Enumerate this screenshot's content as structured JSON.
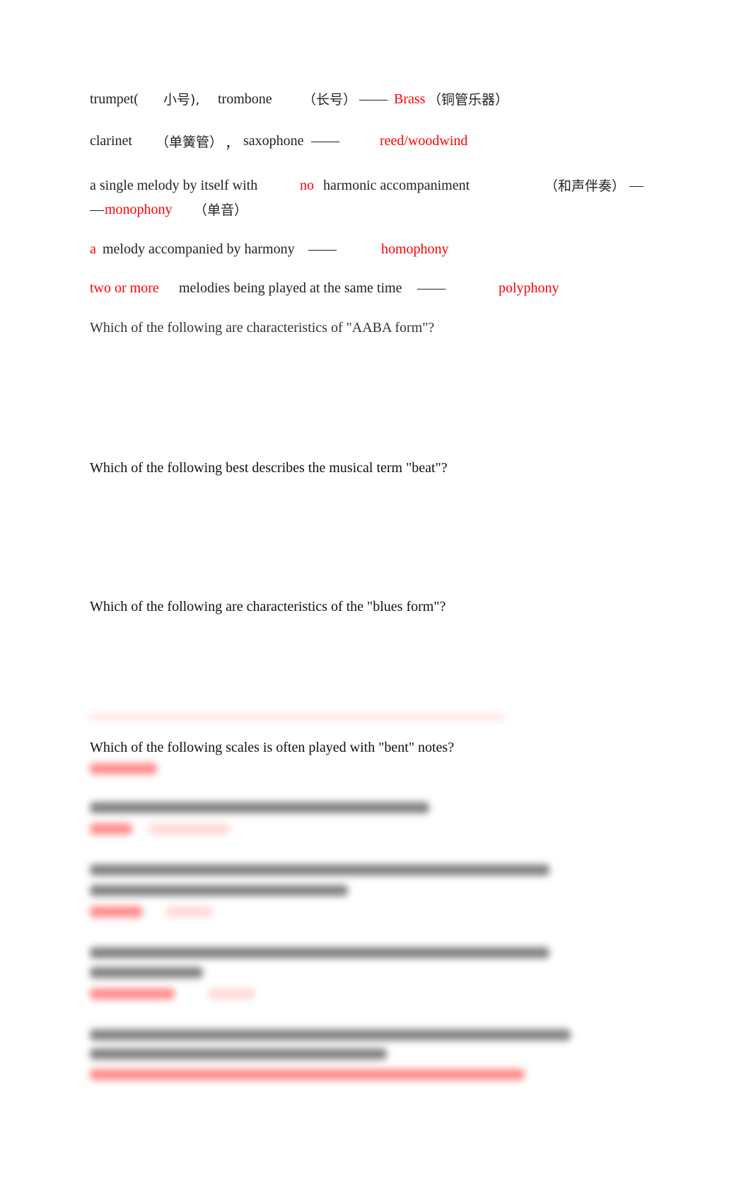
{
  "line1": {
    "trumpet": "trumpet(",
    "trumpet_cn": "小号),",
    "trombone": "trombone",
    "trombone_cn": "（长号）",
    "dash": "——",
    "answer": "Brass",
    "answer_cn": "（铜管乐器）"
  },
  "line2": {
    "clarinet": "clarinet",
    "clarinet_cn": "（单簧管）",
    "comma": "，",
    "saxophone": "saxophone",
    "dash": "——",
    "answer": "reed/woodwind"
  },
  "line3": {
    "text1": "a single melody by itself with",
    "no": "no",
    "text2": "harmonic accompaniment",
    "cn": "（和声伴奏）",
    "dash1": "—",
    "dash2": "—",
    "answer": "monophony",
    "answer_cn": "（单音）"
  },
  "line4": {
    "a": "a",
    "text": "melody accompanied by harmony",
    "dash": "——",
    "answer": "homophony"
  },
  "line5": {
    "answer_lead": "two or more",
    "text": "melodies being played at the same time",
    "dash": "——",
    "answer": "polyphony"
  },
  "questions": [
    "Which of the following are characteristics of \"AABA form\"?",
    "Which of the following best describes the musical term \"beat\"?",
    "Which of the following are characteristics of the \"blues form\"?",
    "Which of the following scales is often played with \"bent\" notes?"
  ]
}
